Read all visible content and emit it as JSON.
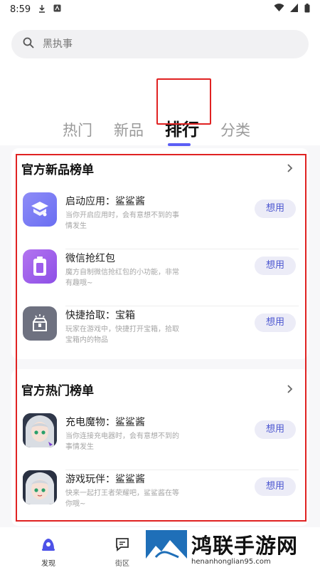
{
  "status_bar": {
    "time": "8:59"
  },
  "search": {
    "placeholder": "黑执事"
  },
  "tabs": [
    {
      "label": "热门"
    },
    {
      "label": "新品"
    },
    {
      "label": "排行"
    },
    {
      "label": "分类"
    }
  ],
  "active_tab": "排行",
  "colors": {
    "accent": "#5b5ef5",
    "button_text": "#4a55d0",
    "button_bg": "#ececf7",
    "highlight": "#e02222"
  },
  "sections": [
    {
      "title": "官方新品榜单",
      "items": [
        {
          "name": "启动应用：鲨鲨酱",
          "desc": "当你开启应用时，会有意想不到的事情发生",
          "button": "想用",
          "icon": "stack-icon"
        },
        {
          "name": "微信抢红包",
          "desc": "魔方自制微信抢红包的小功能，非常有趣哦~",
          "button": "想用",
          "icon": "battery-icon"
        },
        {
          "name": "快捷拾取：宝箱",
          "desc": "玩家在游戏中，快捷打开宝箱，拾取宝箱内的物品",
          "button": "想用",
          "icon": "treasure-chest-icon"
        }
      ]
    },
    {
      "title": "官方热门榜单",
      "items": [
        {
          "name": "充电魔物：鲨鲨酱",
          "desc": "当你连接充电器时，会有意想不到的事情发生",
          "button": "想用",
          "icon": "anime-avatar-icon"
        },
        {
          "name": "游戏玩伴：鲨鲨酱",
          "desc": "快来一起打王者荣耀吧，鲨鲨酱在等你哦~",
          "button": "想用",
          "icon": "anime-avatar-icon"
        }
      ]
    }
  ],
  "bottom_nav": [
    {
      "label": "发现"
    },
    {
      "label": "街区"
    }
  ],
  "watermark": {
    "title": "鸿联手游网",
    "url": "henanhonglian95.com"
  }
}
